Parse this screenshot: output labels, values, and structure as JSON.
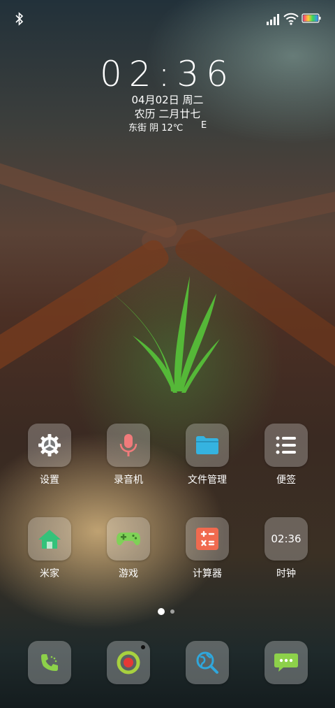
{
  "status_bar": {
    "bluetooth_icon": "bluetooth-icon",
    "signal_icon": "signal-icon",
    "wifi_icon": "wifi-icon",
    "battery_icon": "battery-icon"
  },
  "lockscreen_widget": {
    "time": "02:36",
    "date": "04月02日 周二",
    "lunar_date": "农历 二月廿七",
    "weather": "东街 阴 12℃",
    "weather_extra": "E"
  },
  "home_grid": [
    {
      "label": "设置",
      "icon": "settings-gear-icon"
    },
    {
      "label": "录音机",
      "icon": "microphone-icon"
    },
    {
      "label": "文件管理",
      "icon": "folder-icon"
    },
    {
      "label": "便签",
      "icon": "notes-list-icon"
    },
    {
      "label": "米家",
      "icon": "home-icon"
    },
    {
      "label": "游戏",
      "icon": "gamepad-icon"
    },
    {
      "label": "计算器",
      "icon": "calculator-icon"
    },
    {
      "label": "时钟",
      "icon": "clock-icon",
      "display": "02:36"
    }
  ],
  "page_indicator": {
    "pages": 2,
    "current": 1
  },
  "dock": [
    {
      "icon": "phone-icon"
    },
    {
      "icon": "camera-icon"
    },
    {
      "icon": "browser-icon"
    },
    {
      "icon": "messages-icon"
    }
  ],
  "colors": {
    "settings_icon": "#ffffff",
    "mic_icon": "#f07b7b",
    "folder_icon": "#35b3e0",
    "home_icon": "#34c27a",
    "gamepad_icon": "#7fd157",
    "calculator_bg": "#f06a4f",
    "phone_icon": "#8dd14a",
    "camera_ring": "#a8d13f",
    "camera_center": "#e53935",
    "browser_icon": "#2fa7dc",
    "messages_icon": "#8dd14a"
  }
}
